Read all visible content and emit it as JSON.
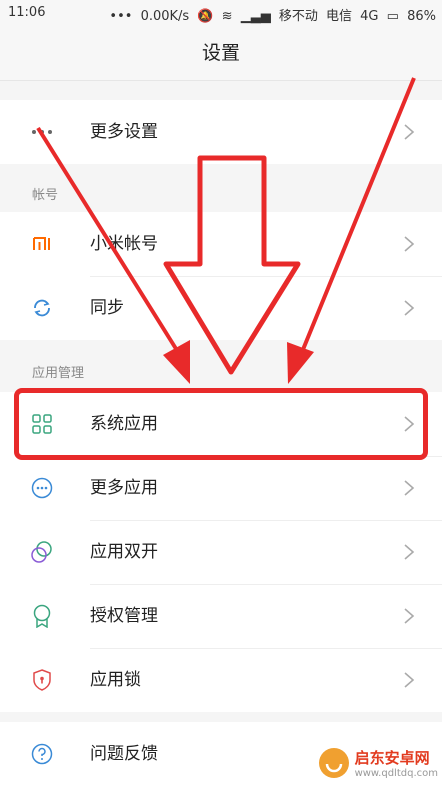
{
  "status_bar": {
    "time": "11:06",
    "network_speed": "0.00K/s",
    "carrier1": "移不动",
    "carrier2": "电信",
    "network_type": "4G",
    "battery": "86%"
  },
  "header": {
    "title": "设置"
  },
  "sections": [
    {
      "header": "",
      "items": [
        {
          "label": "更多设置",
          "icon": "more-dots-icon"
        }
      ]
    },
    {
      "header": "帐号",
      "items": [
        {
          "label": "小米帐号",
          "icon": "mi-logo-icon"
        },
        {
          "label": "同步",
          "icon": "sync-icon"
        }
      ]
    },
    {
      "header": "应用管理",
      "items": [
        {
          "label": "系统应用",
          "icon": "grid-apps-icon"
        },
        {
          "label": "更多应用",
          "icon": "more-circle-icon"
        },
        {
          "label": "应用双开",
          "icon": "dual-circle-icon"
        },
        {
          "label": "授权管理",
          "icon": "badge-icon"
        },
        {
          "label": "应用锁",
          "icon": "shield-lock-icon"
        }
      ]
    },
    {
      "header": "",
      "items": [
        {
          "label": "问题反馈",
          "icon": "help-circle-icon"
        }
      ]
    }
  ],
  "watermark": {
    "text": "启东安卓网",
    "url": "www.qdltdq.com"
  },
  "colors": {
    "highlight": "#e82a2a",
    "accent_green": "#3aa57f",
    "mi_orange": "#ff6a00"
  }
}
